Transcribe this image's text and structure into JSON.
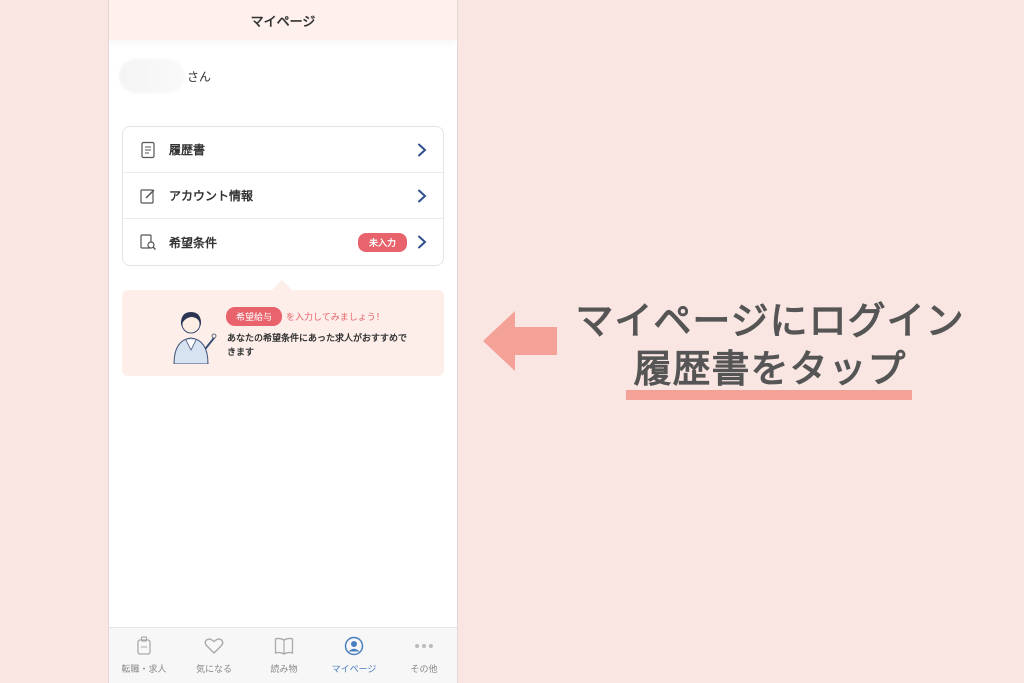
{
  "header": {
    "title": "マイページ"
  },
  "user": {
    "suffix": "さん"
  },
  "menu": {
    "items": [
      {
        "label": "履歴書",
        "icon": "document-icon"
      },
      {
        "label": "アカウント情報",
        "icon": "edit-icon"
      },
      {
        "label": "希望条件",
        "icon": "search-document-icon",
        "badge": "未入力"
      }
    ]
  },
  "promo": {
    "pill": "希望給与",
    "pink_text": "を入力してみましょう！",
    "desc": "あなたの希望条件にあった求人がおすすめできます"
  },
  "tabs": [
    {
      "label": "転職・求人",
      "icon": "job-bag-icon"
    },
    {
      "label": "気になる",
      "icon": "heart-icon"
    },
    {
      "label": "読み物",
      "icon": "book-icon"
    },
    {
      "label": "マイページ",
      "icon": "person-icon",
      "active": true
    },
    {
      "label": "その他",
      "icon": "more-dots-icon"
    }
  ],
  "annotation": {
    "line1": "マイページにログイン",
    "line2": "履歴書をタップ"
  },
  "colors": {
    "background": "#f9e6e3",
    "accent_pink": "#e8636b",
    "arrow": "#f4a197",
    "active_tab": "#4a7fc0",
    "chevron": "#2f4f8f"
  }
}
